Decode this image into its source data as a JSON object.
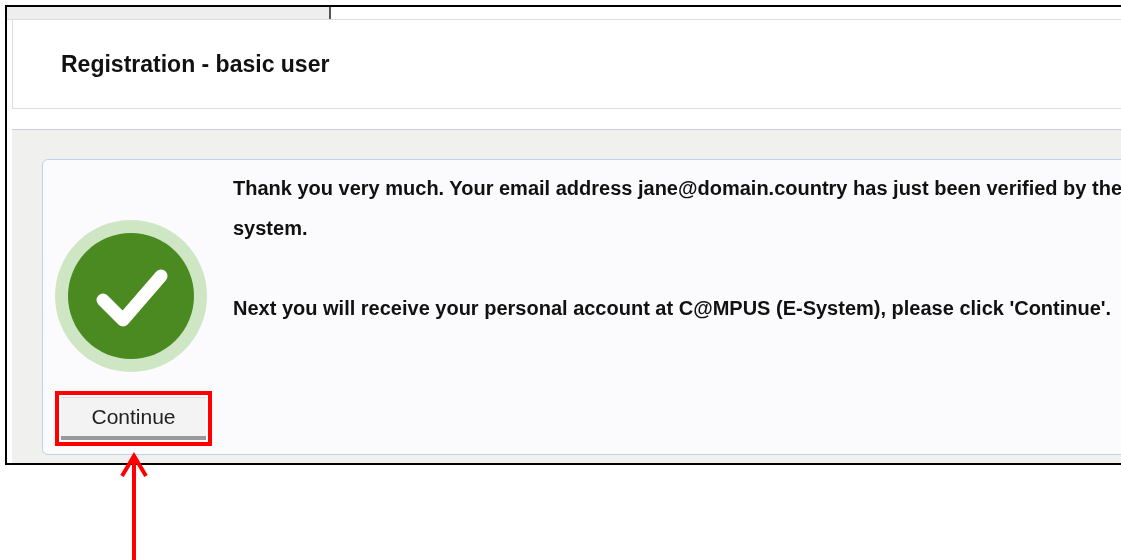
{
  "page": {
    "title": "Registration - basic user"
  },
  "message": {
    "paragraphs": [
      "Thank you very much. Your email address jane@domain.country has just been verified by the system.",
      "Next you will receive your personal account at C@MPUS (E-System), please click 'Continue'."
    ]
  },
  "buttons": [
    {
      "label": "Continue"
    }
  ]
}
